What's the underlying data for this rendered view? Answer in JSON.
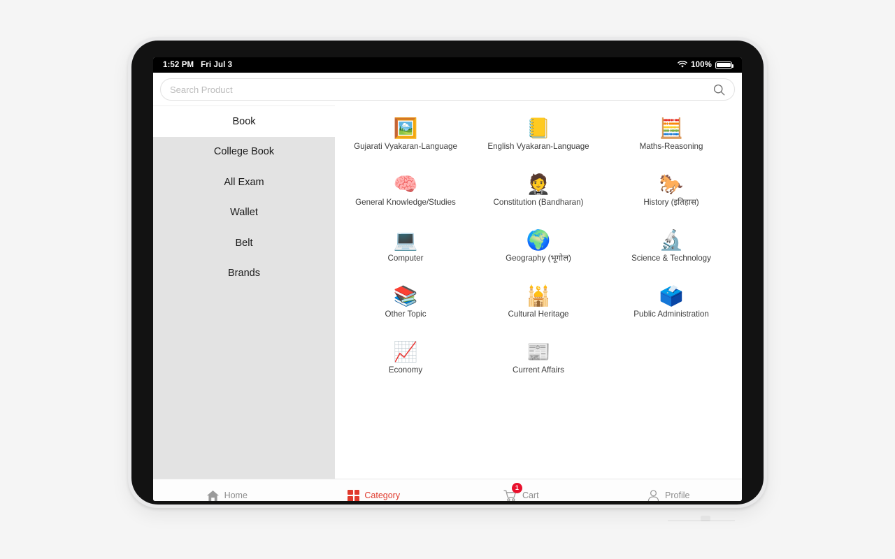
{
  "colors": {
    "background": "#f5f5f5",
    "accent_red": "#e0392c",
    "badge_red": "#e8112d",
    "sidebar_gray": "#e3e3e3",
    "nav_inactive": "#8d8d8d"
  },
  "status_bar": {
    "time": "1:52 PM",
    "date": "Fri Jul 3",
    "wifi_icon": "wifi-icon",
    "battery_percent": "100%",
    "battery_icon": "battery-full-icon"
  },
  "search": {
    "placeholder": "Search Product",
    "value": "",
    "icon": "search-icon"
  },
  "sidebar": {
    "items": [
      {
        "label": "Book",
        "selected": true
      },
      {
        "label": "College Book",
        "selected": false
      },
      {
        "label": "All Exam",
        "selected": false
      },
      {
        "label": "Wallet",
        "selected": false
      },
      {
        "label": "Belt",
        "selected": false
      },
      {
        "label": "Brands",
        "selected": false
      }
    ]
  },
  "categories": [
    {
      "label": "Gujarati Vyakaran-Language",
      "icon": "painting-person-icon",
      "emoji": "🖼️"
    },
    {
      "label": "English Vyakaran-Language",
      "icon": "open-book-icon",
      "emoji": "📒"
    },
    {
      "label": "Maths-Reasoning",
      "icon": "calculator-icon",
      "emoji": "🧮"
    },
    {
      "label": "General Knowledge/Studies",
      "icon": "brain-gear-icon",
      "emoji": "🧠"
    },
    {
      "label": "Constitution (Bandharan)",
      "icon": "speaker-person-icon",
      "emoji": "🤵"
    },
    {
      "label": "History (इतिहास)",
      "icon": "horse-rider-icon",
      "emoji": "🐎"
    },
    {
      "label": "Computer",
      "icon": "laptop-desk-icon",
      "emoji": "💻"
    },
    {
      "label": "Geography (भूगोल)",
      "icon": "globe-student-icon",
      "emoji": "🌍"
    },
    {
      "label": "Science & Technology",
      "icon": "scientist-icon",
      "emoji": "🔬"
    },
    {
      "label": "Other Topic",
      "icon": "books-graduation-icon",
      "emoji": "📚"
    },
    {
      "label": "Cultural Heritage",
      "icon": "monument-icon",
      "emoji": "🕌"
    },
    {
      "label": "Public Administration",
      "icon": "ballot-box-icon",
      "emoji": "🗳️"
    },
    {
      "label": "Economy",
      "icon": "money-chart-icon",
      "emoji": "📈"
    },
    {
      "label": "Current Affairs",
      "icon": "breaking-news-icon",
      "emoji": "📰"
    }
  ],
  "bottom_nav": {
    "items": [
      {
        "label": "Home",
        "icon": "home-icon",
        "active": false,
        "badge": ""
      },
      {
        "label": "Category",
        "icon": "category-grid-icon",
        "active": true,
        "badge": ""
      },
      {
        "label": "Cart",
        "icon": "cart-icon",
        "active": false,
        "badge": "1"
      },
      {
        "label": "Profile",
        "icon": "profile-icon",
        "active": false,
        "badge": ""
      }
    ]
  }
}
